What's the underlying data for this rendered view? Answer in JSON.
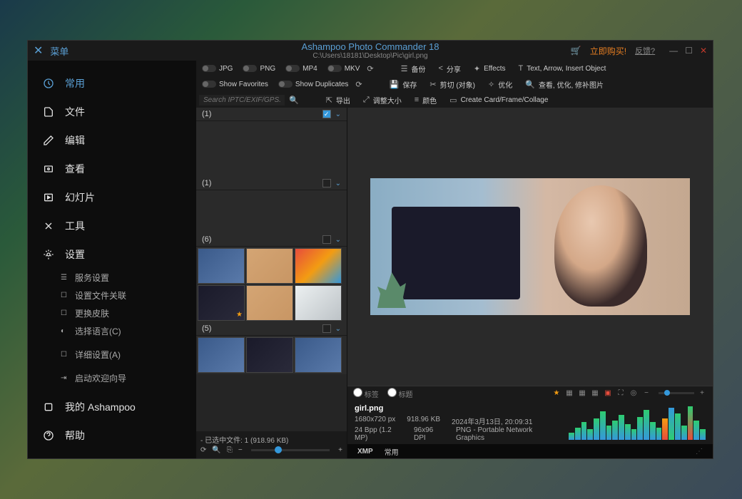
{
  "titlebar": {
    "menu_label": "菜单",
    "app_title": "Ashampoo Photo Commander 18",
    "path": "C:\\Users\\18181\\Desktop\\Pic\\girl.png",
    "buy_now": "立即购买!",
    "feedback": "反馈?"
  },
  "sidebar": {
    "items": [
      {
        "icon": "clock",
        "label": "常用",
        "active": true
      },
      {
        "icon": "file",
        "label": "文件"
      },
      {
        "icon": "pencil",
        "label": "编辑"
      },
      {
        "icon": "eye",
        "label": "查看"
      },
      {
        "icon": "play-box",
        "label": "幻灯片"
      },
      {
        "icon": "tools",
        "label": "工具"
      },
      {
        "icon": "gear",
        "label": "设置"
      }
    ],
    "settings_sub": [
      {
        "icon": "rss",
        "label": "服务设置"
      },
      {
        "icon": "link",
        "label": "设置文件关联"
      },
      {
        "icon": "palette",
        "label": "更换皮肤"
      },
      {
        "icon": "globe",
        "label": "选择语言(C)"
      },
      {
        "icon": "detail",
        "label": "详细设置(A)"
      },
      {
        "icon": "wizard",
        "label": "启动欢迎向导"
      }
    ],
    "my_ashampoo": "我的 Ashampoo",
    "help": "帮助"
  },
  "toolbar": {
    "toggles_row1": [
      "JPG",
      "PNG",
      "MP4",
      "MKV"
    ],
    "toggles_row2": [
      "Show Favorites",
      "Show Duplicates"
    ],
    "search_placeholder": "Search IPTC/EXIF/GPS...",
    "actions": [
      {
        "icon": "backup",
        "label": "备份"
      },
      {
        "icon": "share",
        "label": "分享"
      },
      {
        "icon": "effects",
        "label": "Effects"
      },
      {
        "icon": "text",
        "label": "Text, Arrow, Insert Object"
      },
      {
        "icon": "save",
        "label": "保存"
      },
      {
        "icon": "cut",
        "label": "剪切 (对象)"
      },
      {
        "icon": "optimize",
        "label": "优化"
      },
      {
        "icon": "view-fix",
        "label": "查看, 优化, 修补图片"
      },
      {
        "icon": "export",
        "label": "导出"
      },
      {
        "icon": "resize",
        "label": "调整大小"
      },
      {
        "icon": "color",
        "label": "颜色"
      },
      {
        "icon": "card",
        "label": "Create Card/Frame/Collage"
      }
    ]
  },
  "browser": {
    "groups": [
      {
        "count": "(1)",
        "checked": true
      },
      {
        "count": "(1)",
        "checked": false
      },
      {
        "count": "(6)",
        "checked": false
      },
      {
        "count": "(5)",
        "checked": false
      }
    ],
    "footer_status": "- 已选中文件: 1 (918.96 KB)"
  },
  "viewer": {
    "tag_label": "标签",
    "title_label": "标题"
  },
  "info": {
    "filename": "girl.png",
    "dimensions": "1680x720 px",
    "filesize": "918.96 KB",
    "date": "2024年3月13日, 20:09:31",
    "bpp": "24 Bpp (1.2 MP)",
    "dpi": "96x96 DPI",
    "format": "PNG - Portable Network Graphics"
  },
  "bottom_tabs": {
    "xmp": "XMP",
    "common": "常用"
  }
}
